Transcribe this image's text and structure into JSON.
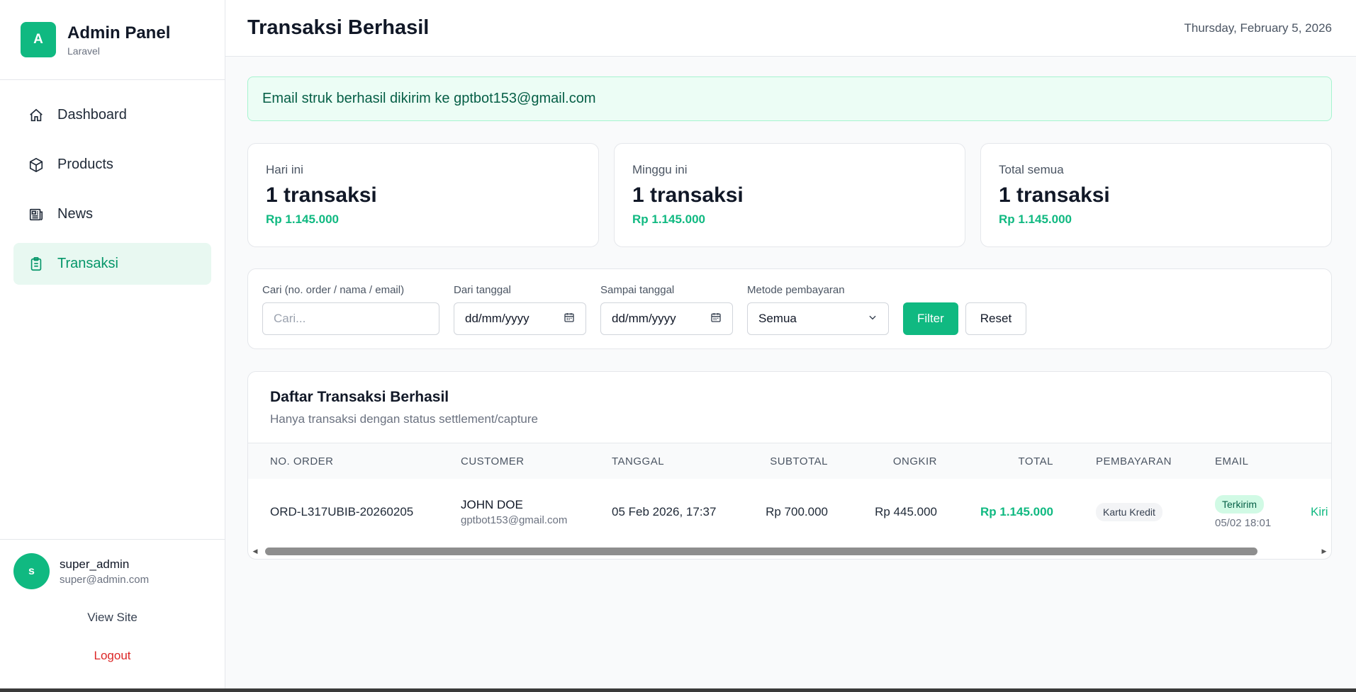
{
  "brand": {
    "logo_letter": "A",
    "title": "Admin Panel",
    "subtitle": "Laravel"
  },
  "nav": [
    {
      "label": "Dashboard",
      "icon": "home-icon"
    },
    {
      "label": "Products",
      "icon": "box-icon"
    },
    {
      "label": "News",
      "icon": "newspaper-icon"
    },
    {
      "label": "Transaksi",
      "icon": "clipboard-icon",
      "active": true
    }
  ],
  "user": {
    "avatar_letter": "s",
    "name": "super_admin",
    "email": "super@admin.com"
  },
  "footer": {
    "view_site": "View Site",
    "logout": "Logout"
  },
  "header": {
    "title": "Transaksi Berhasil",
    "date": "Thursday, February 5, 2026"
  },
  "alert": {
    "message": "Email struk berhasil dikirim ke gptbot153@gmail.com"
  },
  "stats": [
    {
      "label": "Hari ini",
      "value": "1 transaksi",
      "amount": "Rp 1.145.000"
    },
    {
      "label": "Minggu ini",
      "value": "1 transaksi",
      "amount": "Rp 1.145.000"
    },
    {
      "label": "Total semua",
      "value": "1 transaksi",
      "amount": "Rp 1.145.000"
    }
  ],
  "filter": {
    "search_label": "Cari (no. order / nama / email)",
    "search_placeholder": "Cari...",
    "from_label": "Dari tanggal",
    "from_value": "dd/mm/yyyy",
    "to_label": "Sampai tanggal",
    "to_value": "dd/mm/yyyy",
    "method_label": "Metode pembayaran",
    "method_value": "Semua",
    "filter_button": "Filter",
    "reset_button": "Reset"
  },
  "table": {
    "title": "Daftar Transaksi Berhasil",
    "subtitle": "Hanya transaksi dengan status settlement/capture",
    "columns": [
      "NO. ORDER",
      "CUSTOMER",
      "TANGGAL",
      "SUBTOTAL",
      "ONGKIR",
      "TOTAL",
      "PEMBAYARAN",
      "EMAIL"
    ],
    "rows": [
      {
        "order_no": "ORD-L317UBIB-20260205",
        "customer_name": "JOHN DOE",
        "customer_email": "gptbot153@gmail.com",
        "date": "05 Feb 2026, 17:37",
        "subtotal": "Rp 700.000",
        "ongkir": "Rp 445.000",
        "total": "Rp 1.145.000",
        "payment": "Kartu Kredit",
        "email_status": "Terkirim",
        "email_time": "05/02 18:01",
        "action": "Kiri"
      }
    ]
  },
  "colors": {
    "accent": "#10b981",
    "danger": "#dc2626"
  }
}
